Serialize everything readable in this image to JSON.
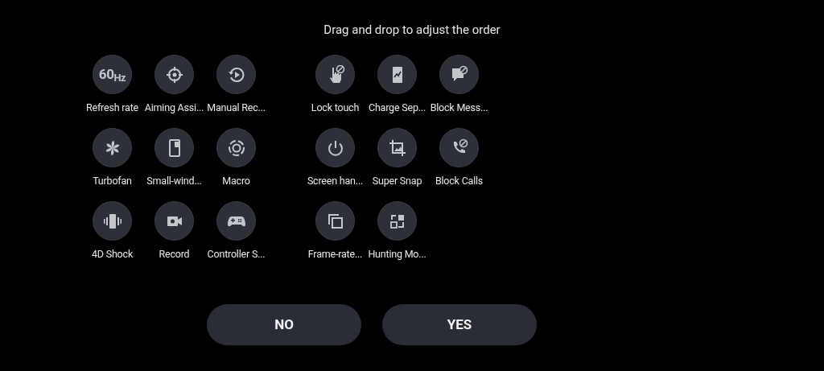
{
  "title": "Drag and drop to adjust the order",
  "groups": [
    {
      "items": [
        {
          "label": "Refresh rate",
          "kind": "refresh",
          "icon_text": "60$_{Hz}$"
        },
        {
          "label": "Aiming Assi...",
          "kind": "crosshair"
        },
        {
          "label": "Manual Rec...",
          "kind": "replay"
        },
        {
          "label": "Turbofan",
          "kind": "fan"
        },
        {
          "label": "Small-wind...",
          "kind": "window"
        },
        {
          "label": "Macro",
          "kind": "macro"
        },
        {
          "label": "4D Shock",
          "kind": "vibrate"
        },
        {
          "label": "Record",
          "kind": "video"
        },
        {
          "label": "Controller S...",
          "kind": "gamepad"
        }
      ]
    },
    {
      "items": [
        {
          "label": "Lock touch",
          "kind": "touch-block"
        },
        {
          "label": "Charge Sep...",
          "kind": "charge"
        },
        {
          "label": "Block Mess...",
          "kind": "message-block"
        },
        {
          "label": "Screen han...",
          "kind": "power"
        },
        {
          "label": "Super Snap",
          "kind": "crop"
        },
        {
          "label": "Block Calls",
          "kind": "call-block"
        },
        {
          "label": "Frame-rate...",
          "kind": "copy"
        },
        {
          "label": "Hunting Mo...",
          "kind": "hunting"
        }
      ]
    }
  ],
  "buttons": [
    {
      "label": "NO"
    },
    {
      "label": "YES"
    }
  ]
}
